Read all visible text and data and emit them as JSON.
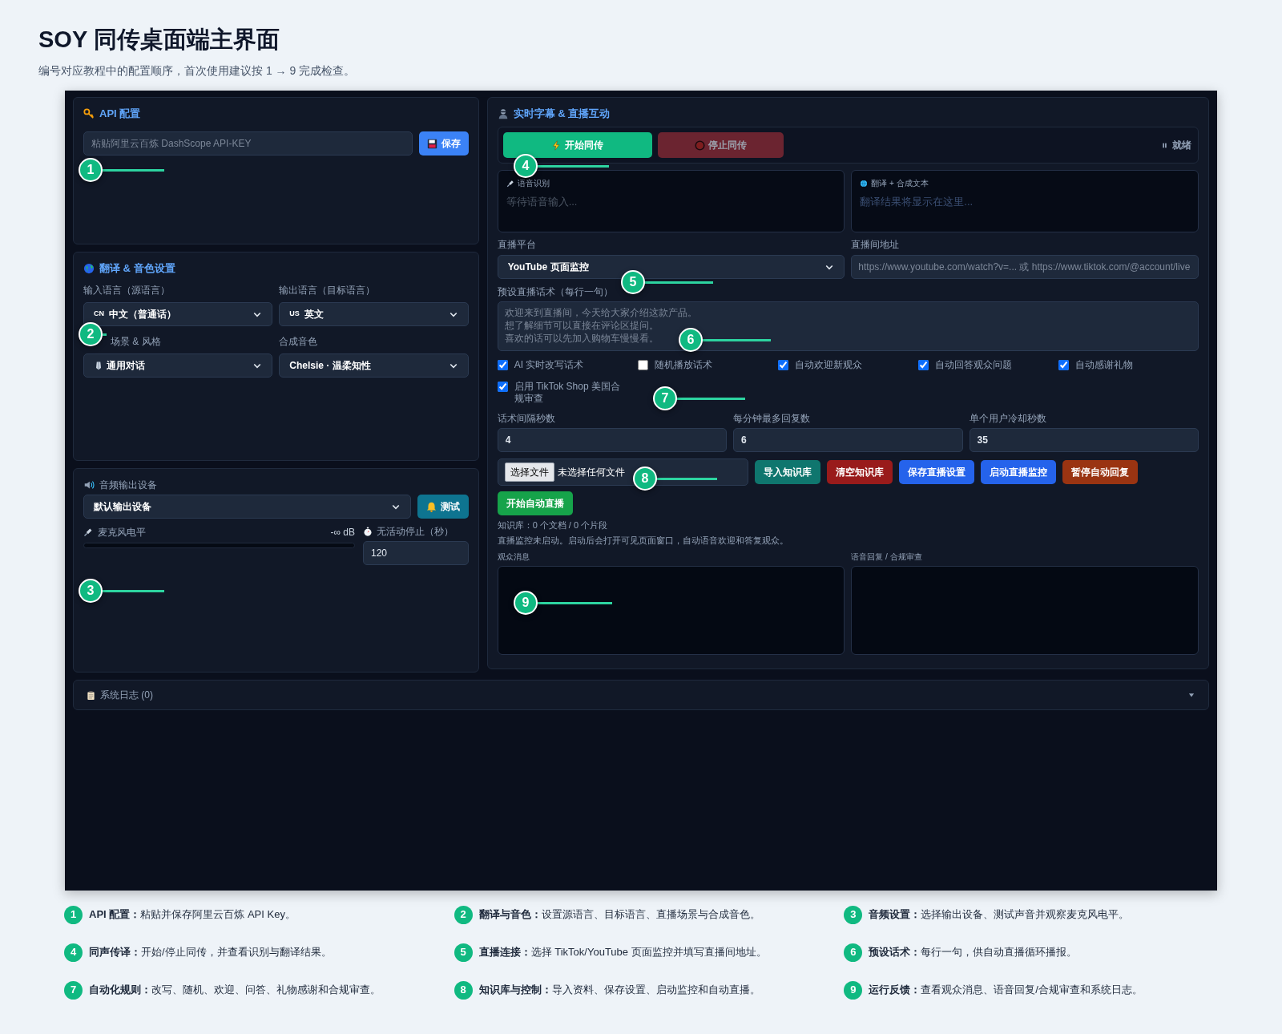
{
  "page": {
    "title": "SOY 同传桌面端主界面",
    "subtitle": "编号对应教程中的配置顺序，首次使用建议按 1 → 9 完成检查。"
  },
  "api": {
    "title": "API 配置",
    "key_field": {
      "placeholder": "粘贴阿里云百炼 DashScope API-KEY"
    },
    "save_button": "保存"
  },
  "translation": {
    "title": "翻译 & 音色设置",
    "fields": [
      {
        "label": "输入语言（源语言）",
        "kind": "flag",
        "flag": "CN",
        "value": "中文（普通话）"
      },
      {
        "label": "输出语言（目标语言）",
        "kind": "flag",
        "flag": "US",
        "value": "英文"
      },
      {
        "label": "场景 & 风格",
        "kind": "icon",
        "value": "通用对话"
      },
      {
        "label": "合成音色",
        "kind": "plain",
        "value": "Chelsie · 温柔知性"
      }
    ]
  },
  "audio": {
    "title": "音频输出设备",
    "device": "默认输出设备",
    "test_button": "测试",
    "mic": {
      "label": "麦克风电平",
      "reading": "-∞ dB",
      "level": 0
    },
    "idle": {
      "label": "无活动停止（秒）",
      "value": "120"
    }
  },
  "live": {
    "title": "实时字幕 & 直播互动",
    "start_button": {
      "label": "开始同传",
      "disabled": false
    },
    "stop_button": {
      "label": "停止同传",
      "disabled": true
    },
    "status": "就绪",
    "recognition": {
      "label": "语音识别",
      "placeholder": "等待语音输入..."
    },
    "translation": {
      "label": "翻译 + 合成文本",
      "placeholder": "翻译结果将显示在这里..."
    },
    "platform": {
      "label": "直播平台",
      "value": "YouTube 页面监控"
    },
    "room_url": {
      "label": "直播间地址",
      "placeholder": "https://www.youtube.com/watch?v=... 或 https://www.tiktok.com/@account/live"
    },
    "scripts": {
      "label": "预设直播话术（每行一句）",
      "placeholder_lines": [
        "欢迎来到直播间，今天给大家介绍这款产品。",
        "想了解细节可以直接在评论区提问。",
        "喜欢的话可以先加入购物车慢慢看。"
      ]
    },
    "options": [
      {
        "label": "AI 实时改写话术",
        "checked": true
      },
      {
        "label": "随机播放话术",
        "checked": false
      },
      {
        "label": "自动欢迎新观众",
        "checked": true
      },
      {
        "label": "自动回答观众问题",
        "checked": true
      },
      {
        "label": "自动感谢礼物",
        "checked": true
      },
      {
        "label": "启用 TikTok Shop 美国合规审查",
        "checked": true
      }
    ],
    "numbers": [
      {
        "label": "话术间隔秒数",
        "value": "4"
      },
      {
        "label": "每分钟最多回复数",
        "value": "6"
      },
      {
        "label": "单个用户冷却秒数",
        "value": "35"
      }
    ],
    "file": {
      "button": "选择文件",
      "status": "未选择任何文件"
    },
    "actions": [
      {
        "label": "导入知识库",
        "color": "#0f766e"
      },
      {
        "label": "清空知识库",
        "color": "#991b1b"
      },
      {
        "label": "保存直播设置",
        "color": "#2563eb"
      },
      {
        "label": "启动直播监控",
        "color": "#2563eb"
      },
      {
        "label": "暂停自动回复",
        "color": "#9a3412"
      }
    ],
    "start_auto": "开始自动直播",
    "kb_status": "知识库：0 个文档 / 0 个片段",
    "monitor_status": "直播监控未启动。启动后会打开可见页面窗口，自动语音欢迎和答复观众。",
    "audience": {
      "label": "观众消息"
    },
    "replies": {
      "label": "语音回复 / 合规审查"
    }
  },
  "log": {
    "label": "系统日志 (0)",
    "expanded": false
  },
  "callouts": [
    "1",
    "2",
    "3",
    "4",
    "5",
    "6",
    "7",
    "8",
    "9"
  ],
  "legend": [
    {
      "number": "1",
      "text": "**API 配置：**粘贴并保存阿里云百炼 API Key。"
    },
    {
      "number": "2",
      "text": "**翻译与音色：**设置源语言、目标语言、直播场景与合成音色。"
    },
    {
      "number": "3",
      "text": "**音频设置：**选择输出设备、测试声音并观察麦克风电平。"
    },
    {
      "number": "4",
      "text": "**同声传译：**开始/停止同传，并查看识别与翻译结果。"
    },
    {
      "number": "5",
      "text": "**直播连接：**选择 TikTok/YouTube 页面监控并填写直播间地址。"
    },
    {
      "number": "6",
      "text": "**预设话术：**每行一句，供自动直播循环播报。"
    },
    {
      "number": "7",
      "text": "**自动化规则：**改写、随机、欢迎、问答、礼物感谢和合规审查。"
    },
    {
      "number": "8",
      "text": "**知识库与控制：**导入资料、保存设置、启动监控和自动直播。"
    },
    {
      "number": "9",
      "text": "**运行反馈：**查看观众消息、语音回复/合规审查和系统日志。"
    }
  ]
}
